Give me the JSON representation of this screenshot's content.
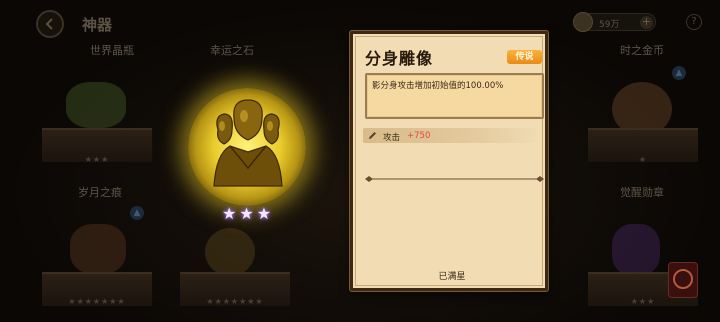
{
  "header": {
    "title": "神器",
    "currency_value": "59万",
    "plus_label": "+",
    "help_label": "?"
  },
  "artifacts": {
    "row1": [
      "世界晶瓶",
      "幸运之石",
      "时之金币"
    ],
    "row2": [
      "岁月之痕",
      "觉醒勋章"
    ],
    "featured_stars": 3
  },
  "detail": {
    "title": "分身雕像",
    "rarity": "传说",
    "description": "影分身攻击增加初始值的100.00%",
    "stat_label": "攻击",
    "stat_value": "+750",
    "status": "已满星"
  },
  "colors": {
    "rarity_badge": "#f0a02a",
    "stat_value": "#e14a3a",
    "panel_bg": "#f1dcb4",
    "glow": "#e9cc2c",
    "star": "#a97cff"
  }
}
